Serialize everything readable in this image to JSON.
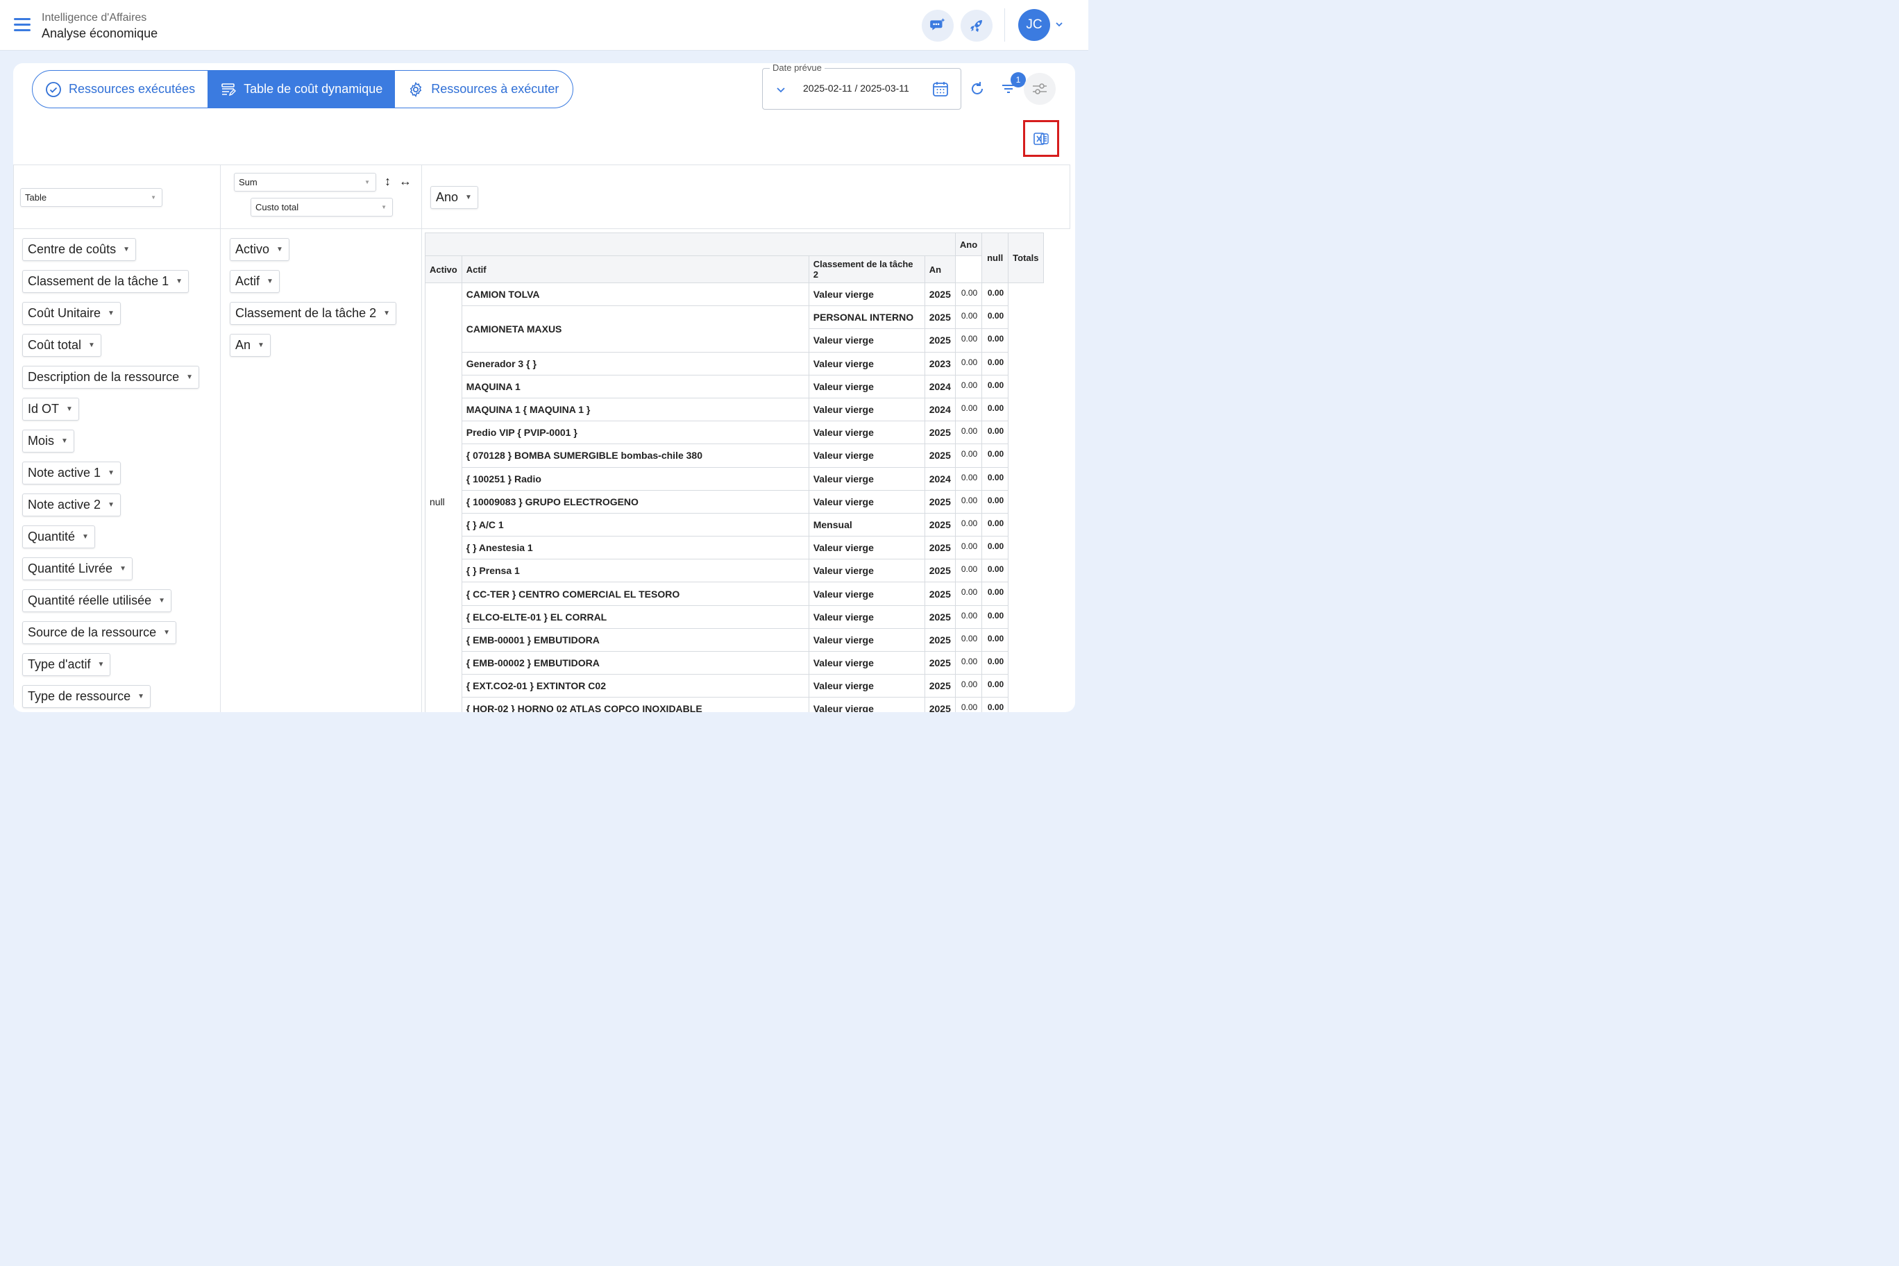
{
  "header": {
    "subtitle": "Intelligence d'Affaires",
    "title": "Analyse économique",
    "avatar_initials": "JC"
  },
  "tabs": [
    {
      "label": "Ressources exécutées",
      "icon": "check-circle-icon",
      "active": false
    },
    {
      "label": "Table de coût dynamique",
      "icon": "table-edit-icon",
      "active": true
    },
    {
      "label": "Ressources à exécuter",
      "icon": "gear-icon",
      "active": false
    }
  ],
  "date_filter": {
    "legend": "Date prévue",
    "value": "2025-02-11 / 2025-03-11"
  },
  "filter_badge": "1",
  "pivot": {
    "renderer": "Table",
    "aggregator": "Sum",
    "aggregator_field": "Custo total",
    "col_attrs": [
      "Ano"
    ],
    "unused_attrs": [
      "Centre de coûts",
      "Classement de la tâche 1",
      "Coût Unitaire",
      "Coût total",
      "Description de la ressource",
      "Id OT",
      "Mois",
      "Note active 1",
      "Note active 2",
      "Quantité",
      "Quantité Livrée",
      "Quantité réelle utilisée",
      "Source de la ressource",
      "Type d'actif",
      "Type de ressource"
    ],
    "row_attrs": [
      "Activo",
      "Actif",
      "Classement de la tâche 2",
      "An"
    ]
  },
  "table": {
    "col_header_label": "Ano",
    "headers": [
      "Activo",
      "Actif",
      "Classement de la tâche 2",
      "An",
      "null",
      "Totals"
    ],
    "activo_value": "null",
    "rows": [
      {
        "actif": "CAMION TOLVA",
        "classement": "Valeur vierge",
        "an": "2025",
        "null": "0.00",
        "total": "0.00"
      },
      {
        "actif": "CAMIONETA MAXUS",
        "classement": "PERSONAL INTERNO",
        "an": "2025",
        "null": "0.00",
        "total": "0.00"
      },
      {
        "actif": "",
        "classement": "Valeur vierge",
        "an": "2025",
        "null": "0.00",
        "total": "0.00"
      },
      {
        "actif": "Generador 3 { }",
        "classement": "Valeur vierge",
        "an": "2023",
        "null": "0.00",
        "total": "0.00"
      },
      {
        "actif": "MAQUINA 1",
        "classement": "Valeur vierge",
        "an": "2024",
        "null": "0.00",
        "total": "0.00"
      },
      {
        "actif": "MAQUINA 1 { MAQUINA 1 }",
        "classement": "Valeur vierge",
        "an": "2024",
        "null": "0.00",
        "total": "0.00"
      },
      {
        "actif": "Predio VIP { PVIP-0001 }",
        "classement": "Valeur vierge",
        "an": "2025",
        "null": "0.00",
        "total": "0.00"
      },
      {
        "actif": "{ 070128 } BOMBA SUMERGIBLE bombas-chile 380",
        "classement": "Valeur vierge",
        "an": "2025",
        "null": "0.00",
        "total": "0.00"
      },
      {
        "actif": "{ 100251 } Radio",
        "classement": "Valeur vierge",
        "an": "2024",
        "null": "0.00",
        "total": "0.00"
      },
      {
        "actif": "{ 10009083 } GRUPO ELECTROGENO",
        "classement": "Valeur vierge",
        "an": "2025",
        "null": "0.00",
        "total": "0.00"
      },
      {
        "actif": "{ } A/C 1",
        "classement": "Mensual",
        "an": "2025",
        "null": "0.00",
        "total": "0.00"
      },
      {
        "actif": "{ } Anestesia 1",
        "classement": "Valeur vierge",
        "an": "2025",
        "null": "0.00",
        "total": "0.00"
      },
      {
        "actif": "{ } Prensa 1",
        "classement": "Valeur vierge",
        "an": "2025",
        "null": "0.00",
        "total": "0.00"
      },
      {
        "actif": "{ CC-TER } CENTRO COMERCIAL EL TESORO",
        "classement": "Valeur vierge",
        "an": "2025",
        "null": "0.00",
        "total": "0.00"
      },
      {
        "actif": "{ ELCO-ELTE-01 } EL CORRAL",
        "classement": "Valeur vierge",
        "an": "2025",
        "null": "0.00",
        "total": "0.00"
      },
      {
        "actif": "{ EMB-00001 } EMBUTIDORA",
        "classement": "Valeur vierge",
        "an": "2025",
        "null": "0.00",
        "total": "0.00"
      },
      {
        "actif": "{ EMB-00002 } EMBUTIDORA",
        "classement": "Valeur vierge",
        "an": "2025",
        "null": "0.00",
        "total": "0.00"
      },
      {
        "actif": "{ EXT.CO2-01 } EXTINTOR C02",
        "classement": "Valeur vierge",
        "an": "2025",
        "null": "0.00",
        "total": "0.00"
      },
      {
        "actif": "{ HOR-02 } HORNO 02 ATLAS COPCO INOXIDABLE",
        "classement": "Valeur vierge",
        "an": "2025",
        "null": "0.00",
        "total": "0.00"
      }
    ]
  },
  "colors": {
    "accent": "#3b7be0",
    "highlight": "#d61d1d"
  }
}
